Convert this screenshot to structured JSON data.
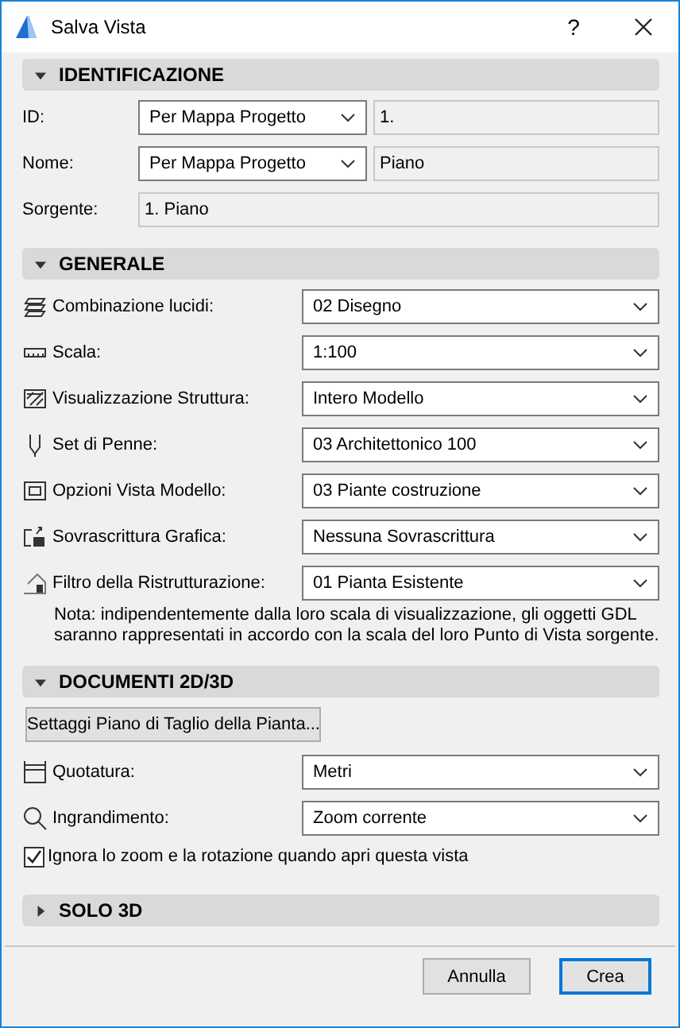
{
  "window": {
    "title": "Salva Vista",
    "help": "?"
  },
  "sections": [
    {
      "title": "IDENTIFICAZIONE",
      "expanded": true,
      "rows": [
        {
          "kind": "pair",
          "label": "ID:",
          "dropdown": "Per Mappa Progetto",
          "value": "1."
        },
        {
          "kind": "pair",
          "label": "Nome:",
          "dropdown": "Per Mappa Progetto",
          "value": "Piano"
        },
        {
          "kind": "field",
          "label": "Sorgente:",
          "value": "1. Piano"
        }
      ]
    },
    {
      "title": "GENERALE",
      "expanded": true,
      "rows": [
        {
          "kind": "dropdown",
          "label": "Combinazione lucidi:",
          "value": "02 Disegno"
        },
        {
          "kind": "dropdown",
          "label": "Scala:",
          "value": "1:100"
        },
        {
          "kind": "dropdown",
          "label": "Visualizzazione Struttura:",
          "value": "Intero Modello"
        },
        {
          "kind": "dropdown",
          "label": "Set di Penne:",
          "value": "03 Architettonico 100"
        },
        {
          "kind": "dropdown",
          "label": "Opzioni Vista Modello:",
          "value": "03 Piante costruzione"
        },
        {
          "kind": "dropdown",
          "label": "Sovrascrittura Grafica:",
          "value": "Nessuna Sovrascrittura"
        },
        {
          "kind": "dropdown",
          "label": "Filtro della Ristrutturazione:",
          "value": "01 Pianta Esistente"
        },
        {
          "kind": "note",
          "text": "Nota: indipendentemente dalla loro scala di visualizzazione, gli oggetti GDL saranno rappresentati in accordo con la scala del loro Punto di Vista sorgente."
        }
      ]
    },
    {
      "title": "DOCUMENTI 2D/3D",
      "expanded": true,
      "rows": [
        {
          "kind": "button",
          "label": "Settaggi Piano di Taglio della Pianta..."
        },
        {
          "kind": "dropdown",
          "label": "Quotatura:",
          "value": "Metri"
        },
        {
          "kind": "dropdown",
          "label": "Ingrandimento:",
          "value": "Zoom corrente"
        },
        {
          "kind": "checkbox",
          "label": "Ignora lo zoom e la rotazione quando apri questa vista",
          "checked": true
        }
      ]
    },
    {
      "title": "SOLO 3D",
      "expanded": false
    }
  ],
  "buttons": [
    {
      "label": "Annulla",
      "default": false
    },
    {
      "label": "Crea",
      "default": true
    }
  ]
}
